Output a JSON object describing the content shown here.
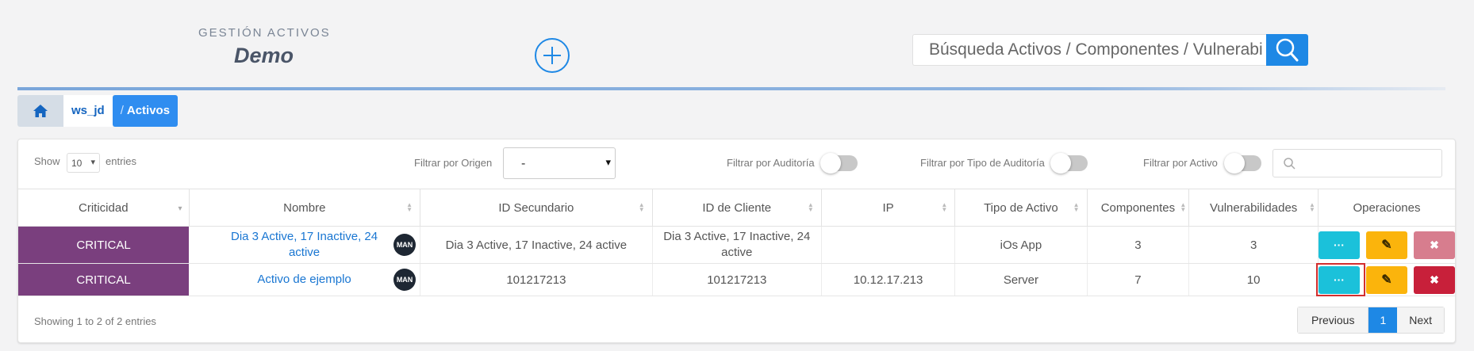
{
  "header": {
    "subtitle": "GESTIÓN ACTIVOS",
    "title": "Demo",
    "search_placeholder": "Búsqueda Activos / Componentes / Vulnerabilidades"
  },
  "breadcrumb": {
    "workspace": "ws_jd",
    "separator": "/",
    "current": "Activos"
  },
  "controls": {
    "show_label": "Show",
    "page_length": "10",
    "entries_label": "entries",
    "origin_label": "Filtrar por Origen",
    "origin_value": "-",
    "audit_label": "Filtrar por Auditoría",
    "audit_type_label": "Filtrar por Tipo de Auditoría",
    "active_label": "Filtrar por Activo"
  },
  "table": {
    "columns": [
      "Criticidad",
      "Nombre",
      "ID Secundario",
      "ID de Cliente",
      "IP",
      "Tipo de Activo",
      "Componentes",
      "Vulnerabilidades",
      "Operaciones"
    ],
    "rows": [
      {
        "criticidad": "CRITICAL",
        "nombre": "Dia 3 Active, 17 Inactive, 24 active",
        "avatar": "MAN",
        "id_secundario": "Dia 3 Active, 17 Inactive, 24 active",
        "id_cliente": "Dia 3 Active, 17 Inactive, 24 active",
        "ip": "",
        "tipo": "iOs App",
        "componentes": "3",
        "vulnerabilidades": "3"
      },
      {
        "criticidad": "CRITICAL",
        "nombre": "Activo de ejemplo",
        "avatar": "MAN",
        "id_secundario": "101217213",
        "id_cliente": "101217213",
        "ip": "10.12.17.213",
        "tipo": "Server",
        "componentes": "7",
        "vulnerabilidades": "10"
      }
    ],
    "ops_glyphs": {
      "view": "···",
      "edit": "✎",
      "delete": "✖"
    }
  },
  "footer": {
    "info": "Showing 1 to 2 of 2 entries",
    "previous": "Previous",
    "current_page": "1",
    "next": "Next"
  },
  "colors": {
    "accent": "#1e88e5",
    "critical": "#7a3f7e",
    "view_btn": "#1bc1da",
    "edit_btn": "#fbb40c",
    "delete_btn": "#c8203a"
  },
  "icons": [
    "plus-circle-icon",
    "search-icon",
    "home-icon",
    "magnifier-icon",
    "sort-icon"
  ]
}
